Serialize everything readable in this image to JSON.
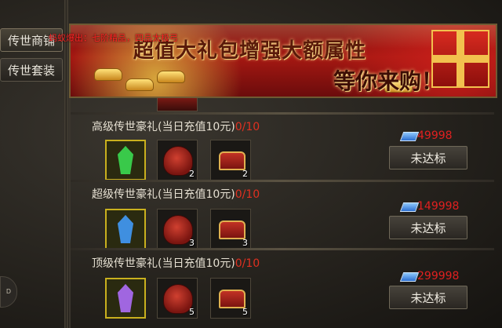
{
  "side_tabs": [
    {
      "label": "传世商铺"
    },
    {
      "label": "传世套装"
    }
  ],
  "scroll_handle": {
    "label": "D"
  },
  "banner": {
    "title": "超值大礼包增强大额属性",
    "subtitle": "等你来购！",
    "drop_notice": "蚂蚁爆出：七阶精品，四品太极弓"
  },
  "packages": [
    {
      "name": "高级传世豪礼(当日充值10元)",
      "progress": "0/10",
      "gem_color": "#39c94a",
      "items": [
        {
          "qty": ""
        },
        {
          "qty": "2"
        },
        {
          "qty": "2"
        }
      ],
      "price": "49998",
      "button": "未达标"
    },
    {
      "name": "超级传世豪礼(当日充值10元)",
      "progress": "0/10",
      "gem_color": "#3f8fe0",
      "items": [
        {
          "qty": ""
        },
        {
          "qty": "3"
        },
        {
          "qty": "3"
        }
      ],
      "price": "149998",
      "button": "未达标"
    },
    {
      "name": "顶级传世豪礼(当日充值10元)",
      "progress": "0/10",
      "gem_color": "#a066e0",
      "items": [
        {
          "qty": ""
        },
        {
          "qty": "5"
        },
        {
          "qty": "5"
        }
      ],
      "price": "299998",
      "button": "未达标"
    }
  ]
}
